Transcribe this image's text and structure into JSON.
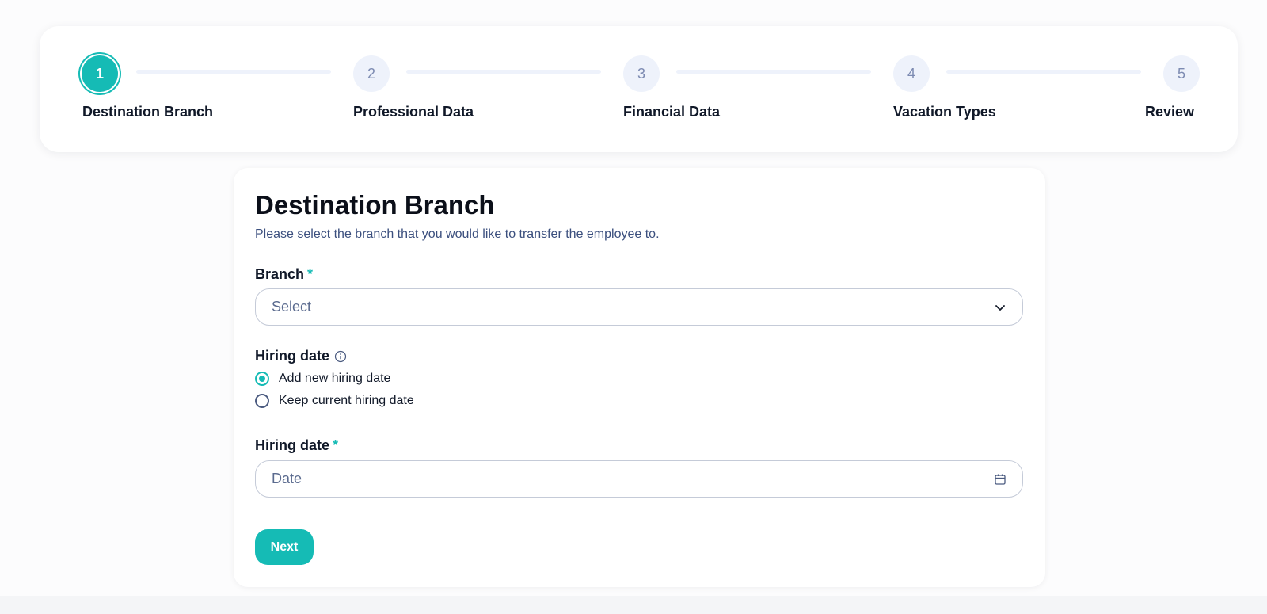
{
  "stepper": {
    "steps": [
      {
        "number": "1",
        "label": "Destination Branch",
        "active": true
      },
      {
        "number": "2",
        "label": "Professional Data",
        "active": false
      },
      {
        "number": "3",
        "label": "Financial Data",
        "active": false
      },
      {
        "number": "4",
        "label": "Vacation Types",
        "active": false
      },
      {
        "number": "5",
        "label": "Review",
        "active": false
      }
    ]
  },
  "form": {
    "title": "Destination Branch",
    "subtitle": "Please select the branch that you would like to transfer the employee to.",
    "branch": {
      "label": "Branch",
      "required_mark": "*",
      "value": "Select"
    },
    "hiring_date_option": {
      "label": "Hiring date",
      "icon": "info-icon",
      "options": [
        {
          "label": "Add new hiring date",
          "checked": true
        },
        {
          "label": "Keep current hiring date",
          "checked": false
        }
      ]
    },
    "hiring_date": {
      "label": "Hiring date",
      "required_mark": "*",
      "placeholder": "Date",
      "icon": "calendar-icon"
    },
    "next_label": "Next"
  },
  "colors": {
    "accent": "#15bbb5",
    "inactive_step": "#eef2fb",
    "subtitle": "#3b4f7e"
  }
}
